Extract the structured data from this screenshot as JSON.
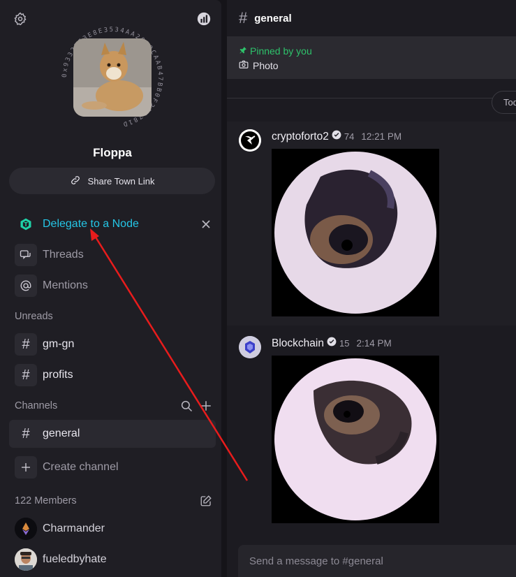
{
  "sidebar": {
    "town_name": "Floppa",
    "ring_text": "0x93327E3E8E3534AA2030CAAB47BB0F232781D",
    "share_label": "Share Town Link",
    "delegate_label": "Delegate to a Node",
    "threads_label": "Threads",
    "mentions_label": "Mentions",
    "unreads_label": "Unreads",
    "unread_channels": [
      "gm-gn",
      "profits"
    ],
    "channels_label": "Channels",
    "active_channel": "general",
    "create_channel_label": "Create channel",
    "members_label": "122 Members",
    "members": [
      "Charmander",
      "fueledbyhate"
    ]
  },
  "main": {
    "channel_name": "general",
    "pinned_label": "Pinned by you",
    "pinned_item": "Photo",
    "date_pill": "Tod",
    "messages": [
      {
        "user": "cryptoforto2",
        "score": "74",
        "time": "12:21 PM"
      },
      {
        "user": "Blockchain",
        "score": "15",
        "time": "2:14 PM"
      }
    ],
    "composer_placeholder": "Send a message to #general"
  },
  "colors": {
    "accent_delegate": "#25c6e6",
    "pinned_green": "#2ec26b",
    "annotation_red": "#e81c1c"
  }
}
